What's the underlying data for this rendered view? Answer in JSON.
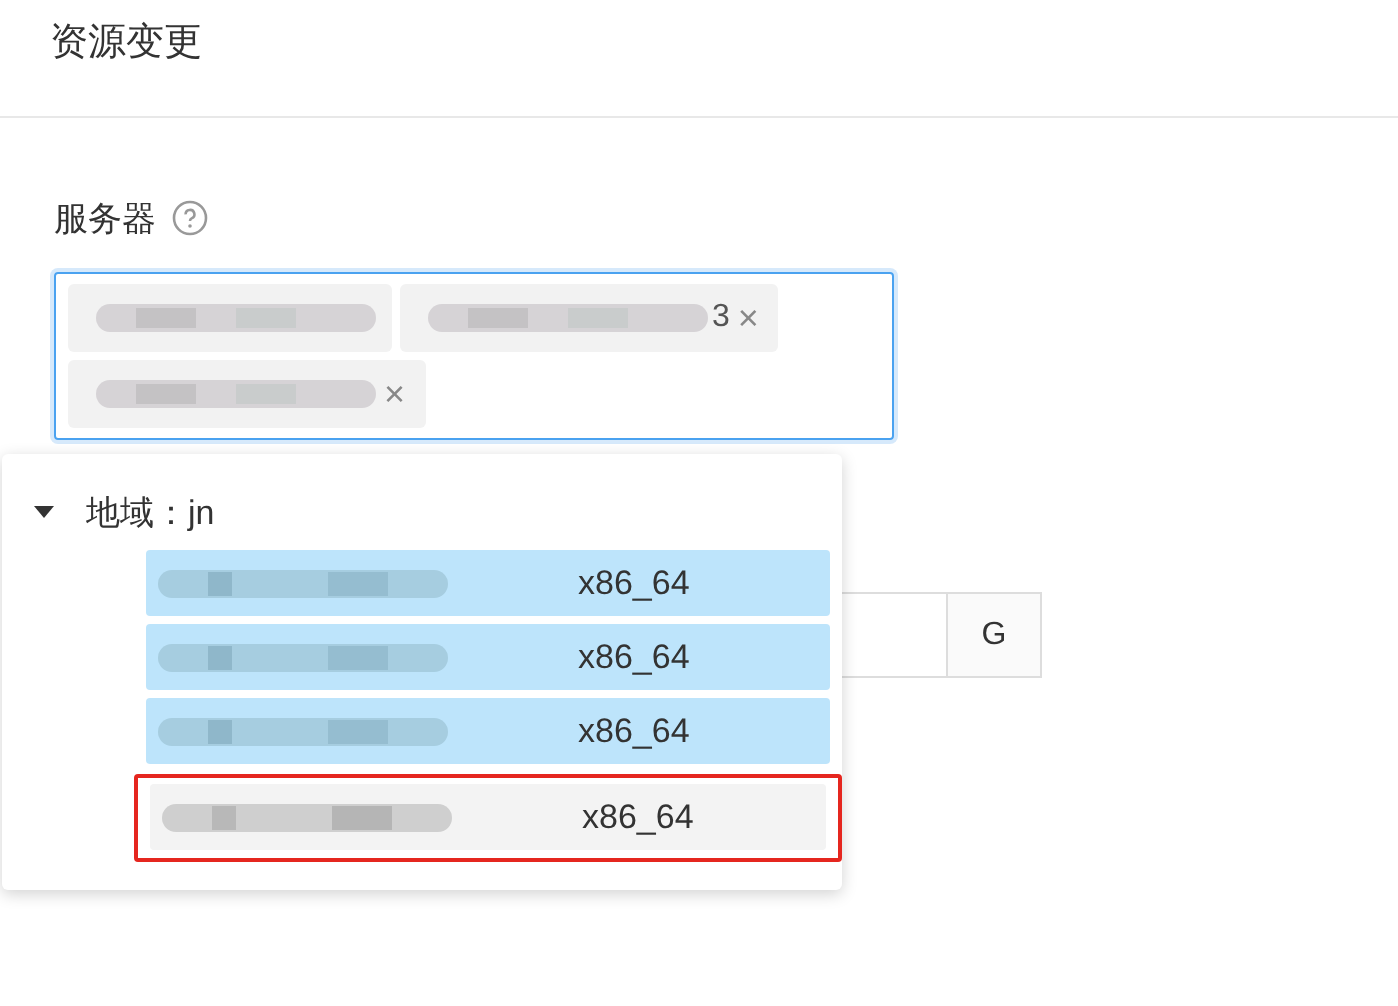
{
  "title": "资源变更",
  "server_field": {
    "label": "服务器",
    "tags": [
      {
        "closable": false
      },
      {
        "closable": true,
        "close": "×",
        "text": "3"
      },
      {
        "closable": true,
        "close": "×"
      }
    ]
  },
  "size_field": {
    "addon": "G"
  },
  "dropdown": {
    "group": {
      "label": "地域：jn",
      "expanded": true,
      "items": [
        {
          "selected": true,
          "arch": "x86_64",
          "highlighted": false
        },
        {
          "selected": true,
          "arch": "x86_64",
          "highlighted": false
        },
        {
          "selected": true,
          "arch": "x86_64",
          "highlighted": false
        },
        {
          "selected": false,
          "arch": "x86_64",
          "highlighted": true
        }
      ]
    }
  }
}
